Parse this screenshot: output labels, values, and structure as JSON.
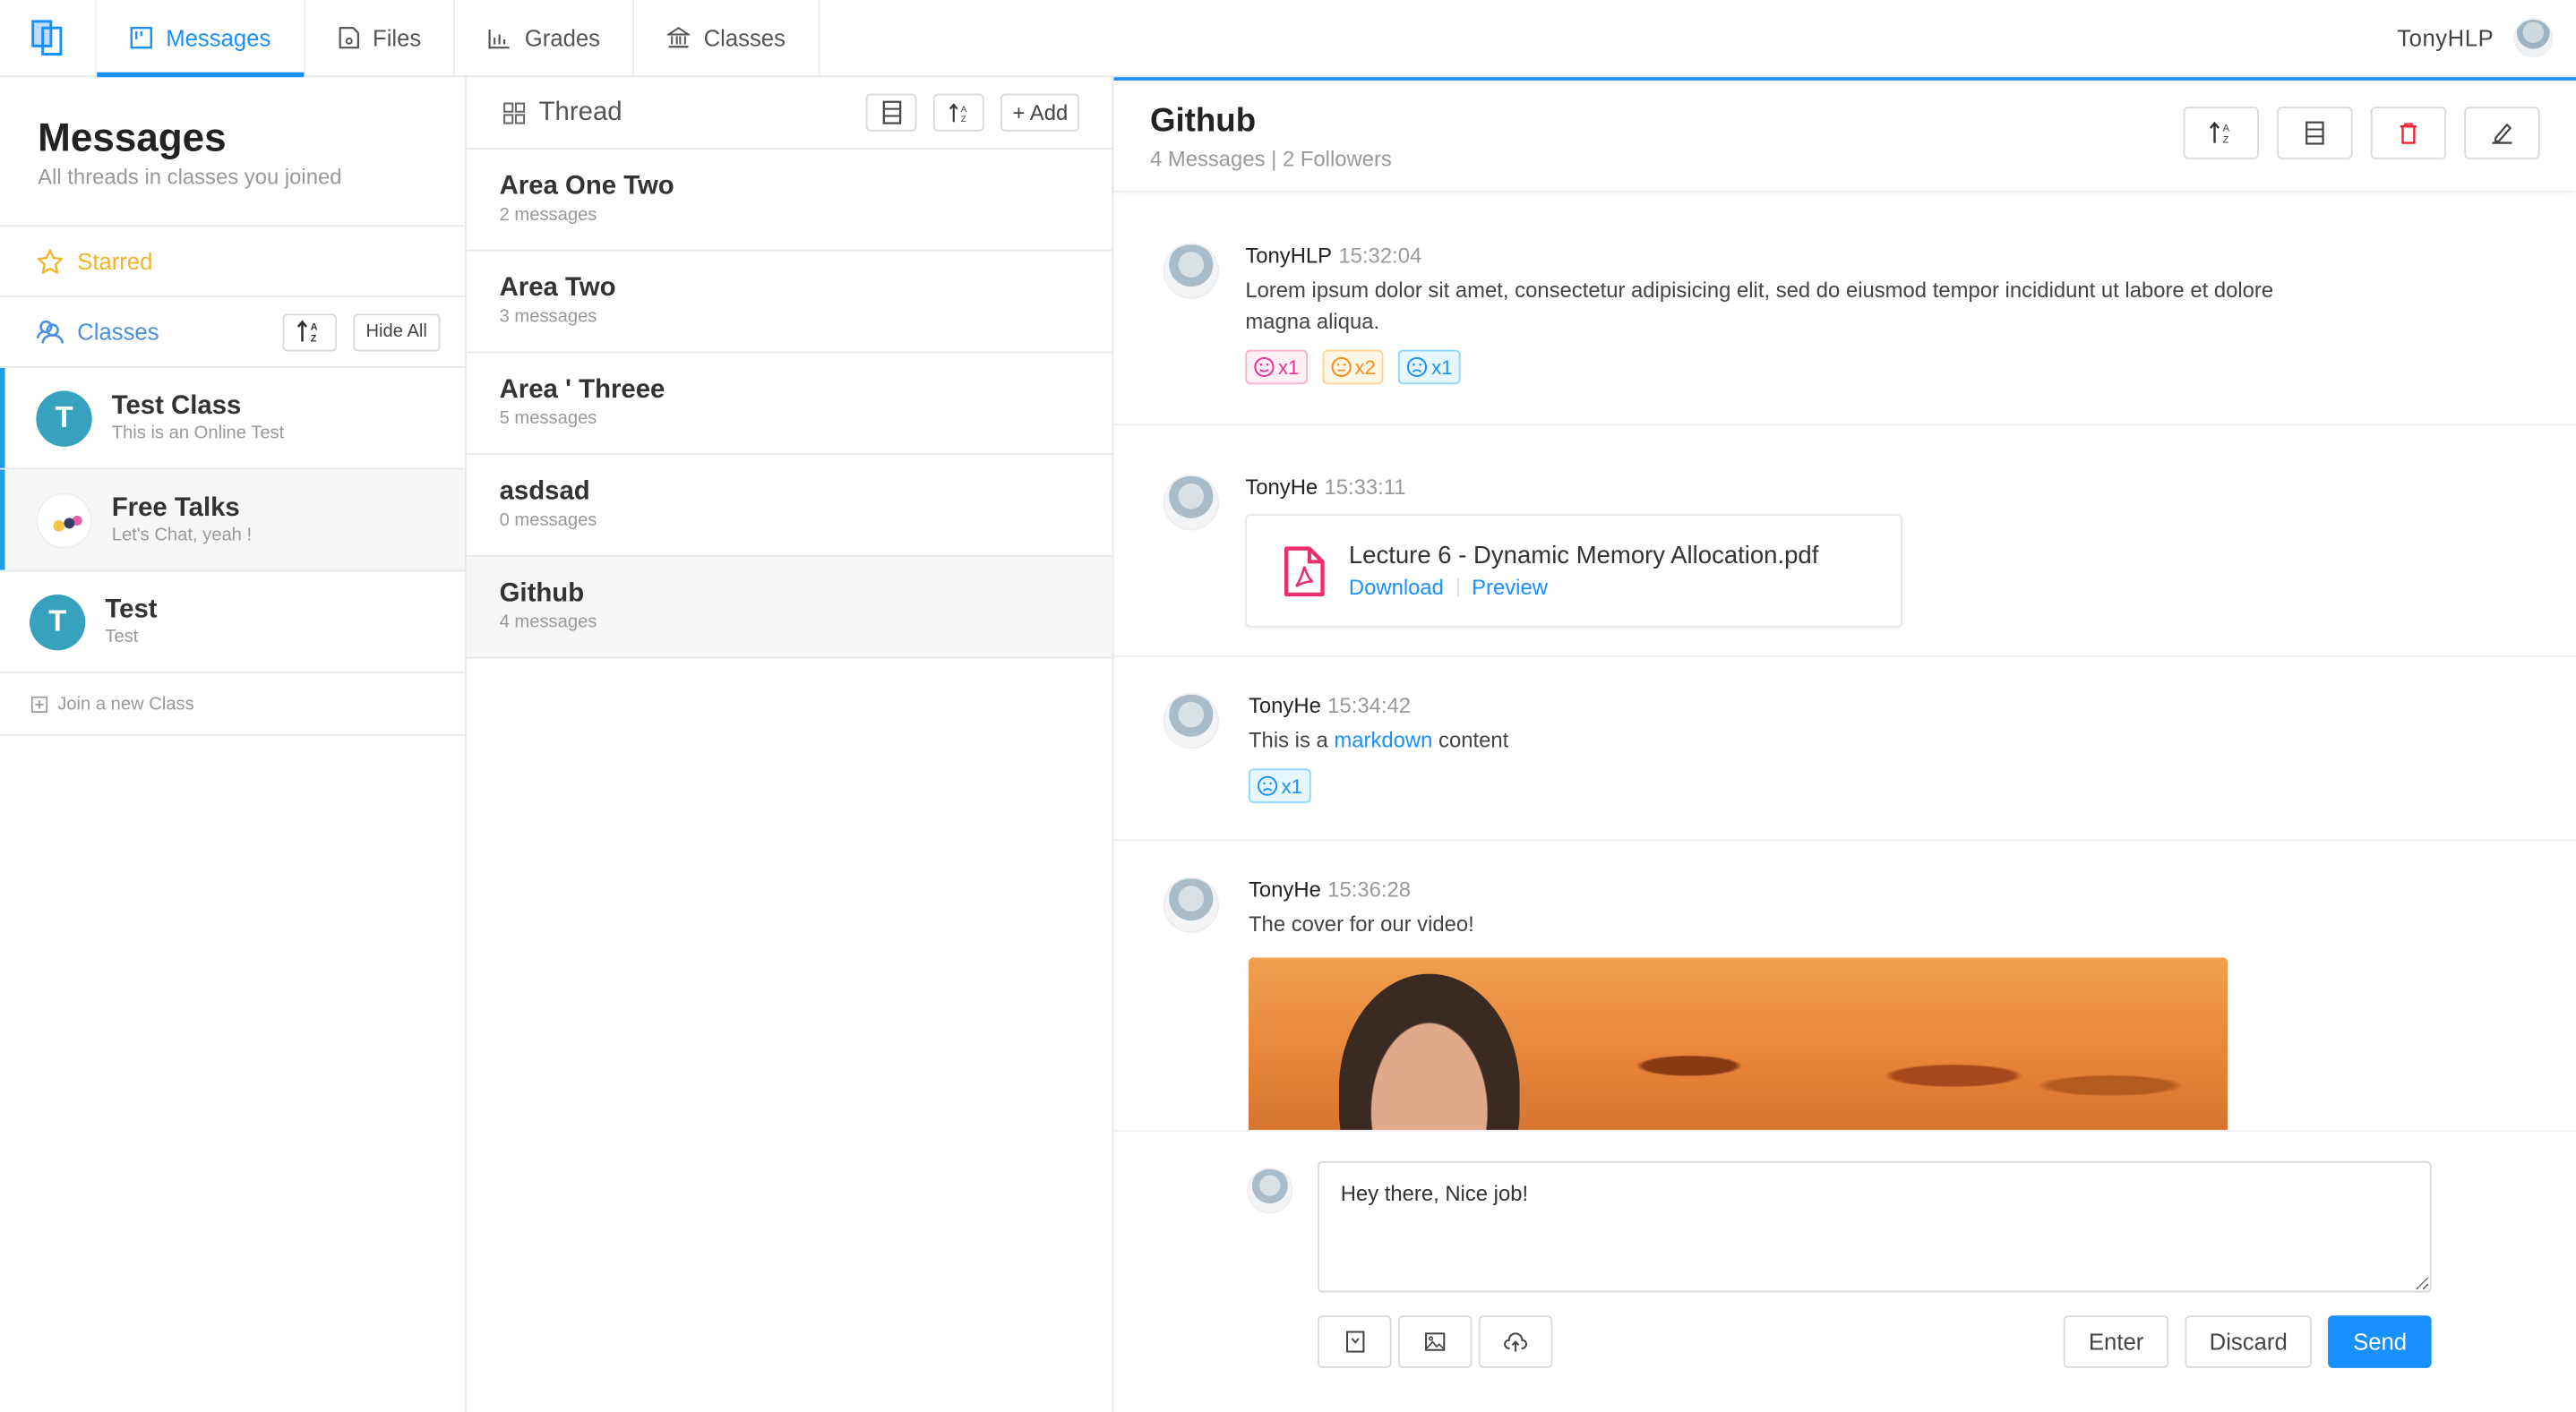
{
  "nav": {
    "tabs": [
      {
        "label": "Messages",
        "icon": "board-icon",
        "active": true
      },
      {
        "label": "Files",
        "icon": "file-icon"
      },
      {
        "label": "Grades",
        "icon": "bar-chart-icon"
      },
      {
        "label": "Classes",
        "icon": "bank-icon"
      }
    ],
    "username": "TonyHLP"
  },
  "sidebar": {
    "title": "Messages",
    "subtitle": "All threads in classes you joined",
    "starred_label": "Starred",
    "classes_label": "Classes",
    "hide_all_label": "Hide All",
    "classes": [
      {
        "name": "Test Class",
        "desc": "This is an Online Test",
        "initial": "T"
      },
      {
        "name": "Free Talks",
        "desc": "Let's Chat, yeah !",
        "initial": ""
      },
      {
        "name": "Test",
        "desc": "Test",
        "initial": "T"
      }
    ],
    "join_label": "Join a new Class"
  },
  "threads": {
    "title": "Thread",
    "add_label": "+ Add",
    "items": [
      {
        "name": "Area One Two",
        "count": "2 messages"
      },
      {
        "name": "Area Two",
        "count": "3 messages"
      },
      {
        "name": "Area ' Threee",
        "count": "5 messages"
      },
      {
        "name": "asdsad",
        "count": "0 messages"
      },
      {
        "name": "Github",
        "count": "4 messages"
      }
    ]
  },
  "main": {
    "title": "Github",
    "subtitle": "4 Messages | 2 Followers",
    "messages": [
      {
        "author": "TonyHLP",
        "time": "15:32:04",
        "body": "Lorem ipsum dolor sit amet, consectetur adipisicing elit, sed do eiusmod tempor incididunt ut labore et dolore magna aliqua.",
        "reactions": [
          {
            "type": "smile",
            "count": "x1",
            "color": "#eb2f96"
          },
          {
            "type": "meh",
            "count": "x2",
            "color": "#fa8c16"
          },
          {
            "type": "frown",
            "count": "x1",
            "color": "#1890ff"
          }
        ]
      },
      {
        "author": "TonyHe",
        "time": "15:33:11",
        "file": {
          "name": "Lecture 6 - Dynamic Memory Allocation.pdf",
          "download": "Download",
          "preview": "Preview"
        }
      },
      {
        "author": "TonyHe",
        "time": "15:34:42",
        "body_pre": "This is a ",
        "body_link": "markdown",
        "body_post": " content",
        "reactions": [
          {
            "type": "frown",
            "count": "x1",
            "color": "#1890ff"
          }
        ]
      },
      {
        "author": "TonyHe",
        "time": "15:36:28",
        "body": "The cover for our video!"
      }
    ]
  },
  "composer": {
    "value": "Hey there, Nice job!",
    "enter_label": "Enter",
    "discard_label": "Discard",
    "send_label": "Send"
  },
  "colors": {
    "accent": "#1890ff",
    "starred": "#f0b429",
    "avatar": "#37a2bd",
    "danger": "#f5222d"
  }
}
